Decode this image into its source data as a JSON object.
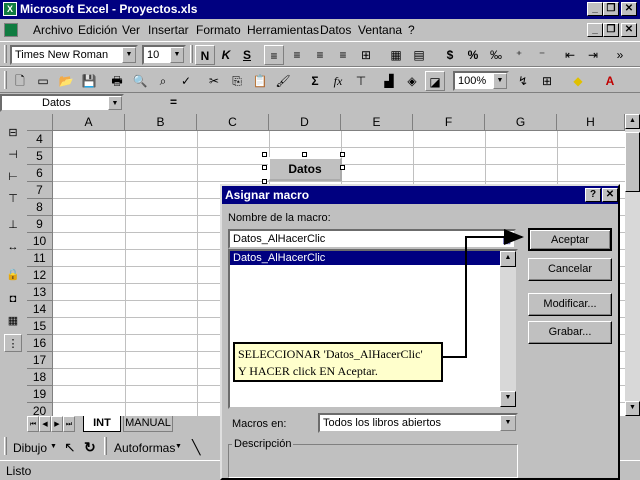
{
  "window": {
    "title": "Microsoft Excel - Proyectos.xls"
  },
  "menu": [
    "Archivo",
    "Edición",
    "Ver",
    "Insertar",
    "Formato",
    "Herramientas",
    "Datos",
    "Ventana",
    "?"
  ],
  "format_toolbar": {
    "font": "Times New Roman",
    "size": "10",
    "bold": "N",
    "italic": "K",
    "underline": "S",
    "currency": "$",
    "percent": "%"
  },
  "standard_toolbar": {
    "zoom": "100%",
    "sigma": "Σ",
    "fx": "fx"
  },
  "formula_bar": {
    "name_box": "Datos",
    "equals": "="
  },
  "grid": {
    "columns": [
      "A",
      "B",
      "C",
      "D",
      "E",
      "F",
      "G",
      "H"
    ],
    "rows": [
      "4",
      "5",
      "6",
      "7",
      "8",
      "9",
      "10",
      "11",
      "12",
      "13",
      "14",
      "15",
      "16",
      "17",
      "18",
      "19",
      "20"
    ]
  },
  "sheet_button": {
    "label": "Datos"
  },
  "sheet_tabs": [
    "INT",
    "MANUAL"
  ],
  "draw_toolbar": {
    "draw": "Dibujo",
    "autoshapes": "Autoformas"
  },
  "status": "Listo",
  "dialog": {
    "title": "Asignar macro",
    "name_label": "Nombre de la macro:",
    "name_value": "Datos_AlHacerClic",
    "list_items": [
      "Datos_AlHacerClic"
    ],
    "buttons": {
      "ok": "Aceptar",
      "cancel": "Cancelar",
      "edit": "Modificar...",
      "record": "Grabar..."
    },
    "macros_in_label": "Macros en:",
    "macros_in_value": "Todos los libros abiertos",
    "description_label": "Descripción"
  },
  "callout": {
    "line1": "SELECCIONAR   'Datos_AlHacerClic'",
    "line2": "Y HACER click EN Aceptar."
  },
  "colors": {
    "titlebar": "#000080",
    "face": "#c0c0c0",
    "selection": "#000080",
    "callout_bg": "#ffffcc"
  }
}
